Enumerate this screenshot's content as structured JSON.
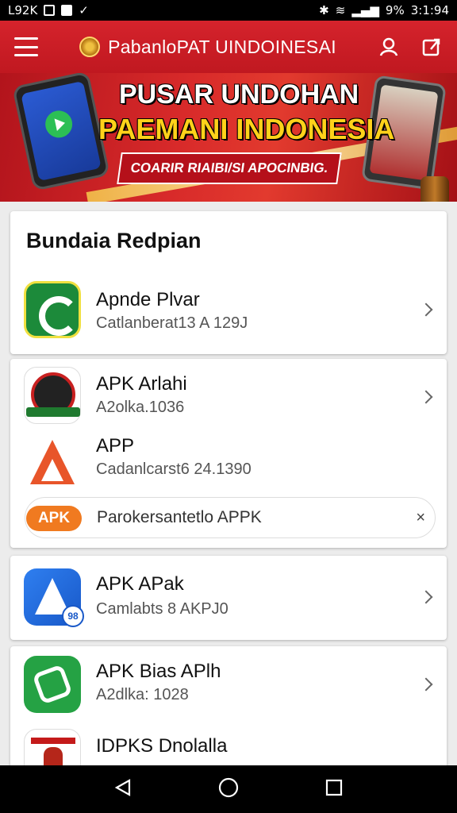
{
  "status_bar": {
    "left_text": "L92K",
    "battery": "9%",
    "time": "3:1:94"
  },
  "app_bar": {
    "title": "PabanloPAT UINDOINESAI"
  },
  "banner": {
    "headline_1": "PUSAR UNDOHAN",
    "headline_2": "PAEMANI INDONESIA",
    "subtitle": "COARIR RIAIBI/SI APOCINBIG."
  },
  "section": {
    "title": "Bundaia Redpian"
  },
  "items": [
    {
      "name": "Apnde Plvar",
      "sub": "Catlanberat13 A 129J",
      "icon": "green-c-app-icon"
    },
    {
      "name": "APK Arlahi",
      "sub": "A2olka.1036",
      "icon": "roulette-app-icon"
    },
    {
      "name": "APP",
      "sub": "Cadanlcarst6 24.1390",
      "icon": "red-a-app-icon"
    },
    {
      "name": "APK APak",
      "sub": "Camlabts 8 AKPJ0",
      "icon": "blue-a-app-icon"
    },
    {
      "name": "APK Bias APlh",
      "sub": "A2dlka: 1028",
      "icon": "green-arrow-app-icon"
    },
    {
      "name": "IDPKS Dnolalla",
      "sub": "",
      "icon": "fifth-app-icon"
    }
  ],
  "promo_pill": {
    "badge": "APK",
    "text": "Parokersantetlo APPK",
    "close": "×"
  },
  "colors": {
    "primary_red": "#d5232c",
    "banner_yellow": "#ffd21a",
    "apk_orange": "#f07a20"
  }
}
